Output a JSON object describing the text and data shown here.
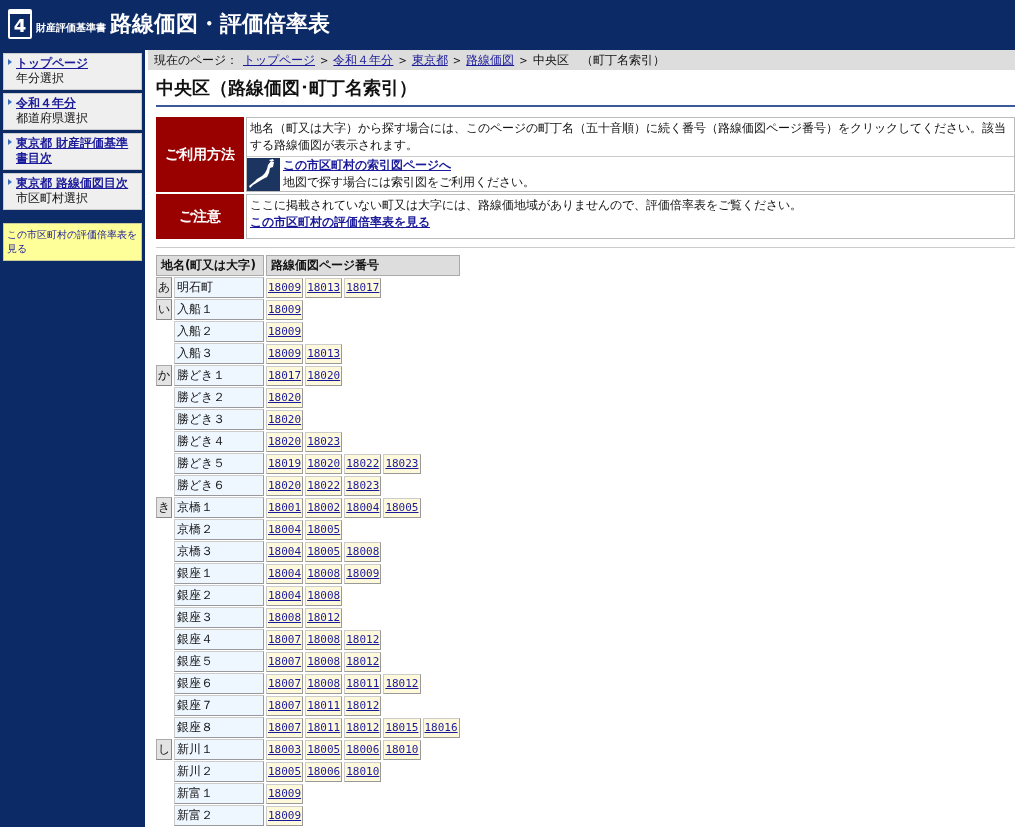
{
  "header": {
    "logo_number": "4",
    "subtitle": "財産評価基準書",
    "title": "路線価図・評価倍率表"
  },
  "sidebar": {
    "items": [
      {
        "link": "トップページ",
        "sub": "年分選択"
      },
      {
        "link": "令和４年分",
        "sub": "都道府県選択"
      },
      {
        "link": "東京都  財産評価基準書目次"
      },
      {
        "link": "東京都  路線価図目次",
        "sub": "市区町村選択"
      }
    ],
    "notice": "この市区町村の評価倍率表を見る"
  },
  "breadcrumb": {
    "label": "現在のページ：",
    "separator": ">",
    "links": [
      "トップページ",
      "令和４年分",
      "東京都",
      "路線価図"
    ],
    "current": "中央区　（町丁名索引）"
  },
  "page_title": "中央区（路線価図･町丁名索引）",
  "info": [
    {
      "kind": "usage",
      "heading": "ご利用方法",
      "text": "地名（町又は大字）から探す場合には、このページの町丁名（五十音順）に続く番号（路線価図ページ番号）をクリックしてください。該当する路線価図が表示されます。",
      "link": "この市区町村の索引図ページへ",
      "note": "地図で探す場合には索引図をご利用ください。"
    },
    {
      "kind": "caution",
      "heading": "ご注意",
      "text": "ここに掲載されていない町又は大字には、路線価地域がありませんので、評価倍率表をご覧ください。",
      "link": "この市区町村の評価倍率表を見る"
    }
  ],
  "table": {
    "columns": [
      "地名(町又は大字)",
      "路線価図ページ番号"
    ],
    "rows": [
      {
        "kana": "あ",
        "name": "明石町",
        "pages": [
          "18009",
          "18013",
          "18017"
        ]
      },
      {
        "kana": "い",
        "name": "入船１",
        "pages": [
          "18009"
        ]
      },
      {
        "name": "入船２",
        "pages": [
          "18009"
        ]
      },
      {
        "name": "入船３",
        "pages": [
          "18009",
          "18013"
        ]
      },
      {
        "kana": "か",
        "name": "勝どき１",
        "pages": [
          "18017",
          "18020"
        ]
      },
      {
        "name": "勝どき２",
        "pages": [
          "18020"
        ]
      },
      {
        "name": "勝どき３",
        "pages": [
          "18020"
        ]
      },
      {
        "name": "勝どき４",
        "pages": [
          "18020",
          "18023"
        ]
      },
      {
        "name": "勝どき５",
        "pages": [
          "18019",
          "18020",
          "18022",
          "18023"
        ]
      },
      {
        "name": "勝どき６",
        "pages": [
          "18020",
          "18022",
          "18023"
        ]
      },
      {
        "kana": "き",
        "name": "京橋１",
        "pages": [
          "18001",
          "18002",
          "18004",
          "18005"
        ]
      },
      {
        "name": "京橋２",
        "pages": [
          "18004",
          "18005"
        ]
      },
      {
        "name": "京橋３",
        "pages": [
          "18004",
          "18005",
          "18008"
        ]
      },
      {
        "name": "銀座１",
        "pages": [
          "18004",
          "18008",
          "18009"
        ]
      },
      {
        "name": "銀座２",
        "pages": [
          "18004",
          "18008"
        ]
      },
      {
        "name": "銀座３",
        "pages": [
          "18008",
          "18012"
        ]
      },
      {
        "name": "銀座４",
        "pages": [
          "18007",
          "18008",
          "18012"
        ]
      },
      {
        "name": "銀座５",
        "pages": [
          "18007",
          "18008",
          "18012"
        ]
      },
      {
        "name": "銀座６",
        "pages": [
          "18007",
          "18008",
          "18011",
          "18012"
        ]
      },
      {
        "name": "銀座７",
        "pages": [
          "18007",
          "18011",
          "18012"
        ]
      },
      {
        "name": "銀座８",
        "pages": [
          "18007",
          "18011",
          "18012",
          "18015",
          "18016"
        ]
      },
      {
        "kana": "し",
        "name": "新川１",
        "pages": [
          "18003",
          "18005",
          "18006",
          "18010"
        ]
      },
      {
        "name": "新川２",
        "pages": [
          "18005",
          "18006",
          "18010"
        ]
      },
      {
        "name": "新富１",
        "pages": [
          "18009"
        ]
      },
      {
        "name": "新富２",
        "pages": [
          "18009"
        ]
      }
    ]
  }
}
